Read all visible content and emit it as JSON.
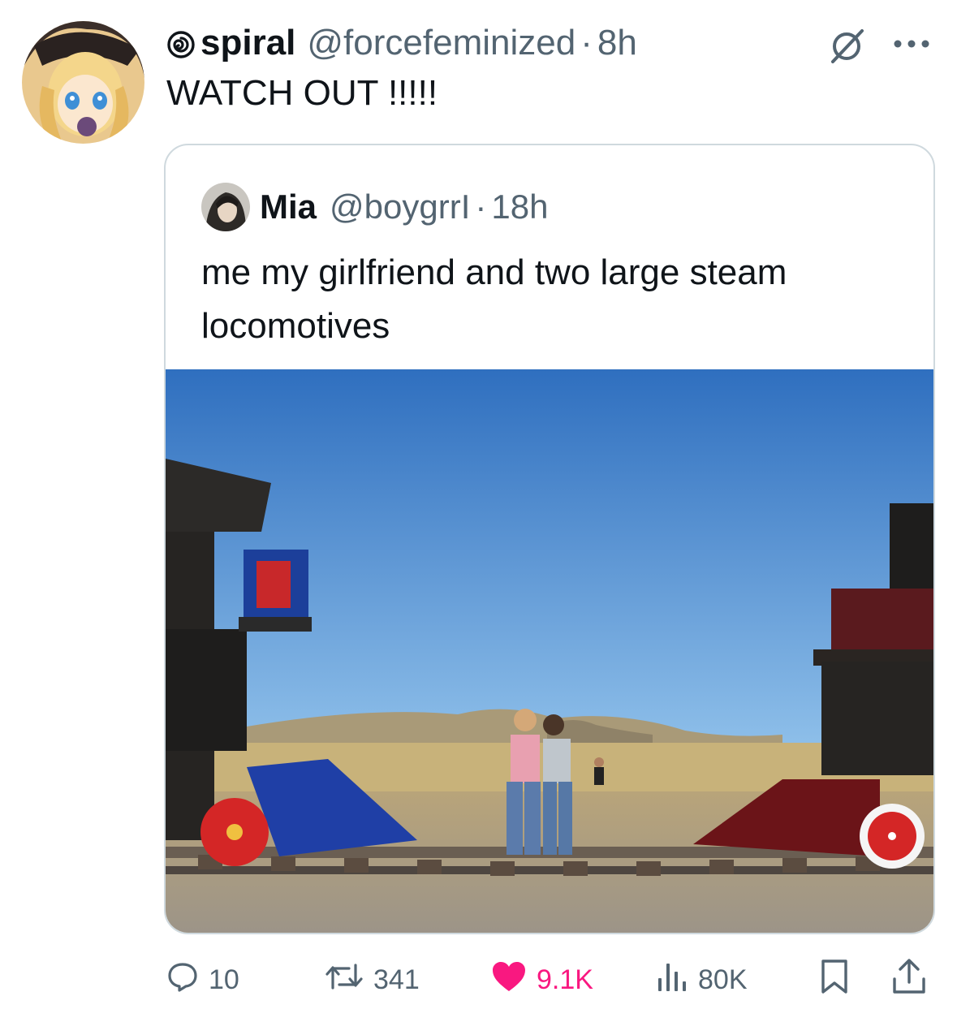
{
  "tweet": {
    "display_name": "spiral",
    "handle": "@forcefeminized",
    "separator": "·",
    "time": "8h",
    "text": "WATCH OUT !!!!!"
  },
  "quoted_tweet": {
    "display_name": "Mia",
    "handle": "@boygrrI",
    "separator": "·",
    "time": "18h",
    "text": "me my girlfriend and two large steam locomotives"
  },
  "actions": {
    "replies": "10",
    "reposts": "341",
    "likes": "9.1K",
    "views": "80K"
  },
  "colors": {
    "text": "#0f1419",
    "secondary": "#536471",
    "like": "#f91880",
    "border": "#cfd9de"
  },
  "icons": [
    "spiral-icon",
    "grok-icon",
    "more-icon",
    "reply-icon",
    "repost-icon",
    "heart-icon",
    "views-icon",
    "bookmark-icon",
    "share-icon"
  ]
}
